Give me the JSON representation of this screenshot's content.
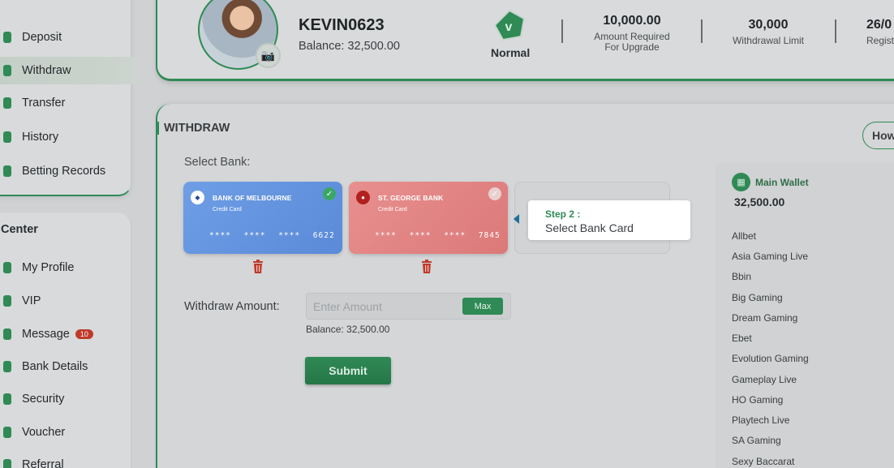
{
  "sidebar": {
    "top_items": [
      {
        "label": "Deposit"
      },
      {
        "label": "Withdraw"
      },
      {
        "label": "Transfer"
      },
      {
        "label": "History"
      },
      {
        "label": "Betting Records"
      }
    ],
    "center_title": "Center",
    "center_items": [
      {
        "label": "My Profile"
      },
      {
        "label": "VIP"
      },
      {
        "label": "Message",
        "badge": "10"
      },
      {
        "label": "Bank Details"
      },
      {
        "label": "Security"
      },
      {
        "label": "Voucher"
      },
      {
        "label": "Referral"
      }
    ]
  },
  "profile": {
    "username": "KEVIN0623",
    "balance": "Balance: 32,500.00",
    "vip_level": "Normal",
    "stats": [
      {
        "value": "10,000.00",
        "label_line1": "Amount Required",
        "label_line2": "For Upgrade"
      },
      {
        "value": "30,000",
        "label_line1": "Withdrawal Limit",
        "label_line2": ""
      },
      {
        "value": "26/0",
        "label_line1": "Regist",
        "label_line2": ""
      }
    ]
  },
  "withdraw": {
    "title": "WITHDRAW",
    "how_button": "How",
    "select_bank_label": "Select Bank:",
    "cards": [
      {
        "bank": "BANK OF MELBOURNE",
        "type": "Credit Card",
        "number": "**** **** **** 6622"
      },
      {
        "bank": "ST. GEORGE BANK",
        "type": "Credit Card",
        "number": "**** **** **** 7845"
      }
    ],
    "tooltip": {
      "step": "Step 2 :",
      "hint": "Select Bank Card"
    },
    "amount_label": "Withdraw Amount:",
    "amount_placeholder": "Enter Amount",
    "max_button": "Max",
    "balance_small": "Balance: 32,500.00",
    "submit_button": "Submit"
  },
  "wallet": {
    "title": "Main Wallet",
    "balance": "32,500.00",
    "providers": [
      "Allbet",
      "Asia Gaming Live",
      "Bbin",
      "Big Gaming",
      "Dream Gaming",
      "Ebet",
      "Evolution Gaming",
      "Gameplay Live",
      "HO Gaming",
      "Playtech Live",
      "SA Gaming",
      "Sexy Baccarat"
    ]
  },
  "colors": {
    "accent": "#2f8a55",
    "danger": "#c0392b",
    "card_blue": "#6f9ee6",
    "card_red": "#e88f8f"
  }
}
